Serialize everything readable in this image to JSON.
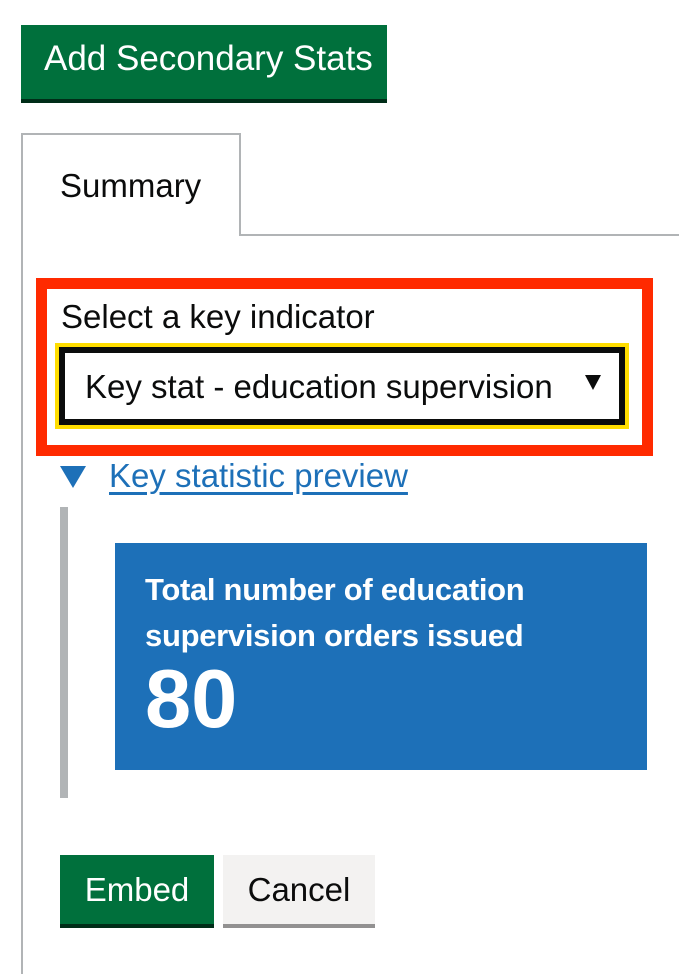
{
  "toolbar": {
    "add_secondary_stats_label": "Add Secondary Stats"
  },
  "tabs": [
    {
      "label": "Summary",
      "selected": true
    }
  ],
  "key_indicator": {
    "label": "Select a key indicator",
    "selected_value": "Key stat - education supervision"
  },
  "preview": {
    "summary_label": "Key statistic preview",
    "expanded": true,
    "tile": {
      "title": "Total number of education supervision orders issued",
      "value": "80"
    }
  },
  "actions": {
    "embed_label": "Embed",
    "cancel_label": "Cancel"
  },
  "colors": {
    "primary_button": "#00703c",
    "tile_background": "#1d70b8",
    "link": "#1d70b8",
    "highlight_border": "#ff2a00",
    "focus": "#ffdd00"
  }
}
